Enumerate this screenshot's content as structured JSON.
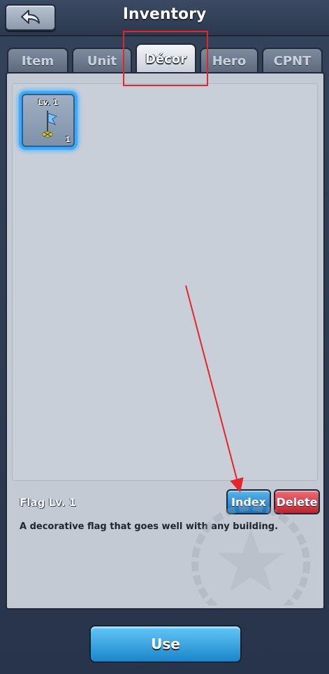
{
  "header": {
    "title": "Inventory",
    "back_icon": "back-arrow-icon"
  },
  "tabs": [
    {
      "label": "Item",
      "active": false
    },
    {
      "label": "Unit",
      "active": false
    },
    {
      "label": "Décor",
      "active": true
    },
    {
      "label": "Hero",
      "active": false
    },
    {
      "label": "CPNT",
      "active": false
    }
  ],
  "inventory": {
    "items": [
      {
        "level_label": "Lv. 1",
        "count": "1",
        "icon": "flag-icon",
        "selected": true
      }
    ]
  },
  "detail": {
    "name": "Flag Lv. 1",
    "description": "A decorative flag that goes well with any building.",
    "index_label": "Index",
    "delete_label": "Delete"
  },
  "footer": {
    "use_label": "Use"
  },
  "colors": {
    "annotation_red": "#e8242a",
    "accent_blue": "#3ea9f5",
    "delete_red": "#d0353f"
  }
}
